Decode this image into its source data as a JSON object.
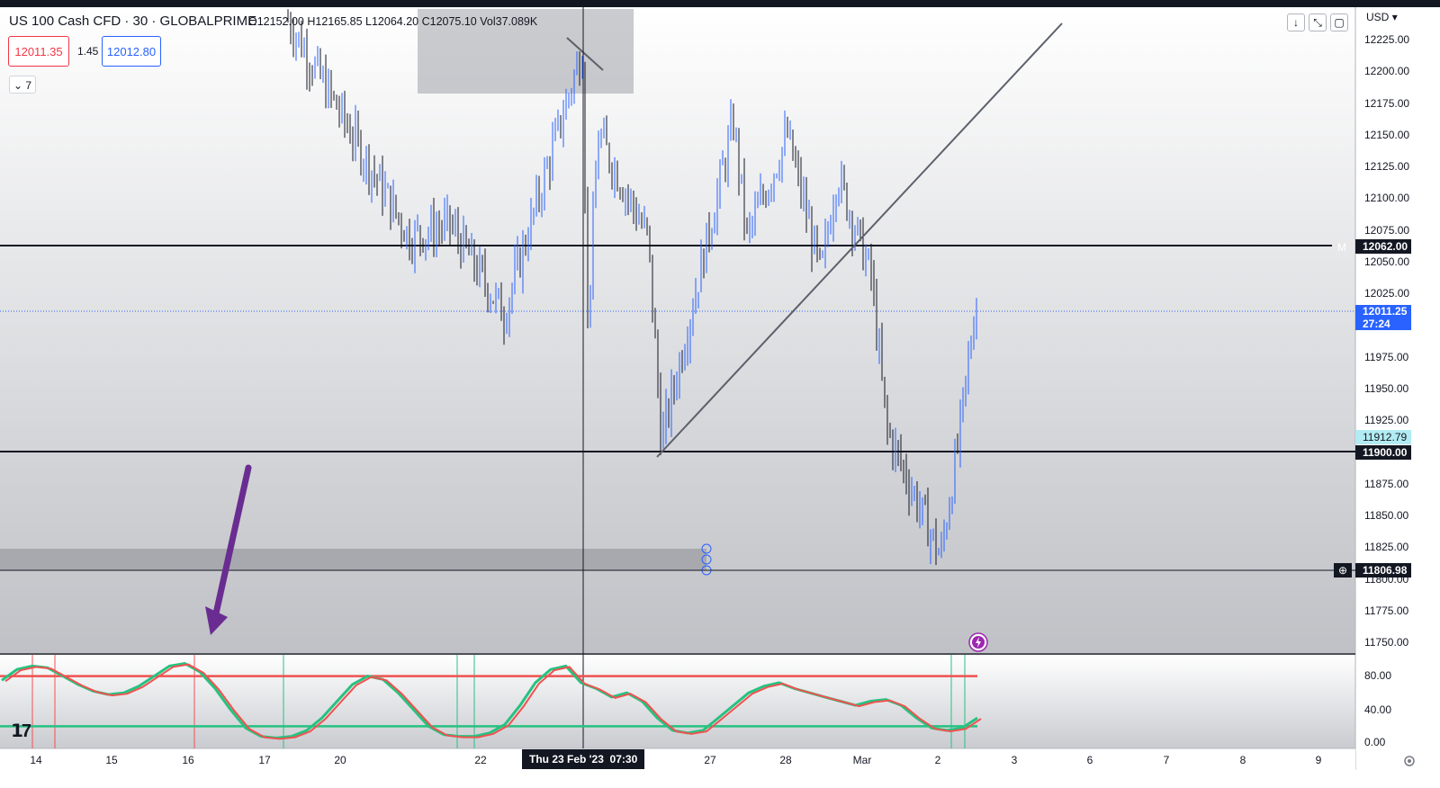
{
  "header": {
    "symbol_title": "US 100 Cash CFD · 30 · GLOBALPRIME",
    "open_label": "O",
    "open_value": "12152.00",
    "high_label": "H",
    "high_value": "12165.85",
    "low_label": "L",
    "low_value": "12064.20",
    "close_label": "C",
    "close_value": "12075.10",
    "vol_label": "Vol",
    "vol_value": "37.089K"
  },
  "trade": {
    "sell_price": "12011.35",
    "spread": "1.45",
    "buy_price": "12012.80"
  },
  "indicators_toggle": {
    "count": "7"
  },
  "currency": "USD",
  "price_axis": {
    "ticks": [
      "12225.00",
      "12200.00",
      "12175.00",
      "12150.00",
      "12125.00",
      "12100.00",
      "12075.00",
      "12050.00",
      "12025.00",
      "11975.00",
      "11950.00",
      "11925.00",
      "11875.00",
      "11850.00",
      "11825.00",
      "11800.00",
      "11775.00",
      "11750.00"
    ],
    "tags": {
      "level_high": "12062.00",
      "last_price": "12011.25",
      "countdown": "27:24",
      "bid_tag": "11912.79",
      "level_mid": "11900.00",
      "crosshair_price": "11806.98"
    }
  },
  "time_axis": {
    "ticks": [
      "14",
      "15",
      "16",
      "17",
      "20",
      "22",
      "27",
      "28",
      "Mar",
      "2",
      "3",
      "6",
      "7",
      "8",
      "9"
    ],
    "crosshair_date": "Thu 23 Feb '23",
    "crosshair_time": "07:30"
  },
  "oscillator": {
    "ticks": [
      "80.00",
      "40.00",
      "0.00"
    ]
  },
  "colors": {
    "candle_up": "#2962ff",
    "candle_down": "#131722",
    "osc_fast": "#26c281",
    "osc_slow": "#f0524f",
    "annotation_arrow": "#6a2c91"
  },
  "icons": [
    "scroll-down-icon",
    "compare-icon",
    "maximize-icon",
    "settings-icon",
    "chevron-down-icon",
    "lightning-icon",
    "tradingview-logo-icon"
  ],
  "chart_data": {
    "type": "candlestick",
    "title": "US 100 Cash CFD · 30 · GLOBALPRIME",
    "xlabel": "",
    "ylabel": "",
    "ylim": [
      11735,
      12240
    ],
    "x": [
      "14",
      "15",
      "16",
      "17",
      "20",
      "22",
      "27",
      "28",
      "Mar",
      "2",
      "3",
      "6",
      "7",
      "8",
      "9"
    ],
    "price_path": [
      {
        "x": "20",
        "y": 12230
      },
      {
        "x": "20",
        "y": 12060
      },
      {
        "x": "22",
        "y": 12070
      },
      {
        "x": "22",
        "y": 12000
      },
      {
        "x": "23 Feb 07:30",
        "y": 12210
      },
      {
        "x": "23 Feb 07:30",
        "y": 11985
      },
      {
        "x": "23 Feb",
        "y": 12140
      },
      {
        "x": "24",
        "y": 12060
      },
      {
        "x": "24",
        "y": 11900
      },
      {
        "x": "27",
        "y": 12150
      },
      {
        "x": "27",
        "y": 12060
      },
      {
        "x": "28",
        "y": 12140
      },
      {
        "x": "28",
        "y": 12030
      },
      {
        "x": "Mar",
        "y": 12110
      },
      {
        "x": "Mar",
        "y": 12030
      },
      {
        "x": "Mar",
        "y": 11910
      },
      {
        "x": "2",
        "y": 11810
      },
      {
        "x": "2",
        "y": 11900
      },
      {
        "x": "2",
        "y": 12020
      }
    ],
    "horizontal_levels": [
      12062.0,
      11900.0,
      11806.98
    ],
    "oscillator": {
      "levels": [
        80,
        20
      ],
      "ylim": [
        0,
        100
      ],
      "values": [
        75,
        88,
        92,
        90,
        80,
        70,
        62,
        58,
        60,
        68,
        80,
        92,
        95,
        85,
        65,
        40,
        18,
        8,
        6,
        8,
        15,
        30,
        50,
        70,
        80,
        76,
        60,
        40,
        20,
        10,
        8,
        8,
        12,
        22,
        45,
        72,
        88,
        92,
        72,
        65,
        55,
        60,
        50,
        30,
        15,
        12,
        15,
        30,
        45,
        60,
        68,
        72,
        65,
        60,
        55,
        50,
        45,
        50,
        52,
        45,
        30,
        18,
        15,
        18,
        30
      ]
    }
  }
}
